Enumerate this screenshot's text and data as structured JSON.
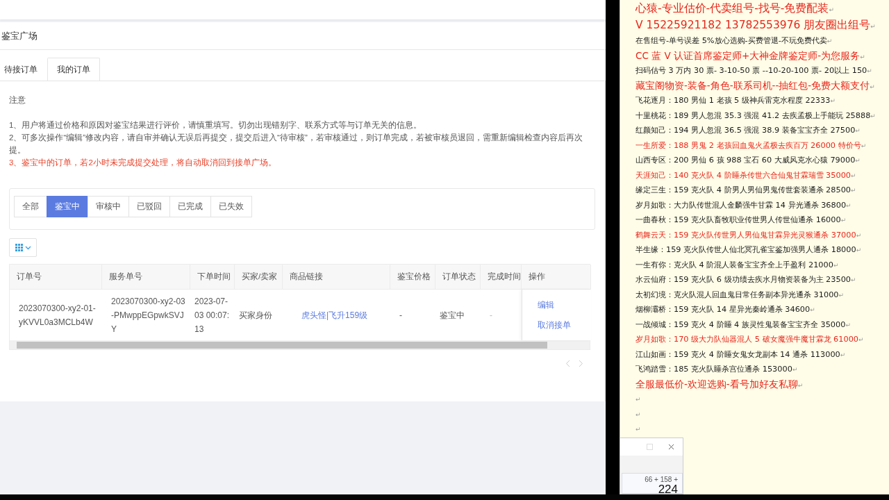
{
  "header": {
    "breadcrumb": "鉴宝广场"
  },
  "tabs": [
    {
      "label": "待接订单",
      "selected": false
    },
    {
      "label": "我的订单",
      "selected": true
    }
  ],
  "notice": {
    "title": "注意",
    "items": [
      {
        "kind": "normal",
        "text": "1、用户将通过价格和原因对鉴宝结果进行评价，请慎重填写。切勿出现错别字、联系方式等与订单无关的信息。"
      },
      {
        "kind": "normal",
        "text": "2、可多次操作“编辑”修改内容，请自审并确认无误后再提交，提交后进入“待审核”，若审核通过，则订单完成，若被审核员退回，需重新编辑检查内容后再次提。"
      },
      {
        "kind": "warning",
        "text": "3、鉴宝中的订单，若2小时未完成提交处理，将自动取消回到接单广场。"
      }
    ]
  },
  "filters": [
    {
      "label": "全部",
      "selected": false
    },
    {
      "label": "鉴宝中",
      "selected": true
    },
    {
      "label": "审核中",
      "selected": false
    },
    {
      "label": "已驳回",
      "selected": false
    },
    {
      "label": "已完成",
      "selected": false
    },
    {
      "label": "已失效",
      "selected": false
    }
  ],
  "table": {
    "columns": [
      "订单号",
      "服务单号",
      "下单时间",
      "买家/卖家",
      "商品链接",
      "鉴宝价格",
      "订单状态",
      "完成时间",
      "操作"
    ],
    "rows": [
      {
        "order_no": "2023070300-xy2-01-yKVVL0a3MCLb4W",
        "service_no": "2023070300-xy2-03-PMwppEGpwkSVJY",
        "time": "2023-07-03 00:07:13",
        "role": "买家身份",
        "link": "虎头怪|飞升159级",
        "price": "-",
        "status": "鉴宝中",
        "done_time": "-",
        "actions": [
          "编辑",
          "取消接单"
        ]
      }
    ]
  },
  "document": {
    "lines": [
      {
        "kind": "heading",
        "color": "#e8261c",
        "text": "心猿-专业估价-代卖组号-找号-免费配装",
        "mark": "↵"
      },
      {
        "kind": "heading",
        "color": "#e8261c",
        "text": "V 15225921182   13782553976 朋友圈出组号",
        "mark": "↵"
      },
      {
        "kind": "entry",
        "color": "#1a1a1a",
        "text": "在售组号-单号误差 5%放心选购-买费管退-不玩免费代卖",
        "mark": "↵"
      },
      {
        "kind": "subheading",
        "color": "#e8261c",
        "text": "CC 蓝 V 认证首席鉴定师+大神金牌鉴定师-为您服务",
        "mark": "↵"
      },
      {
        "kind": "entry",
        "color": "#1a1a1a",
        "text": "扫码估号 3 万内 30 票- 3-10-50 票  --10-20-100 票- 20以上 150",
        "mark": "↵"
      },
      {
        "kind": "subheading",
        "color": "#e8261c",
        "text": "藏宝阁物资-装备-角色-联系司机--抽红包-免费大额支付",
        "mark": "↵"
      },
      {
        "kind": "entry",
        "color": "#1a1a1a",
        "text": "飞花逐月：180 男仙 1 老孩 5 级神兵雷克水程度 22333",
        "mark": "↵"
      },
      {
        "kind": "entry",
        "color": "#1a1a1a",
        "text": "十里桃花：189 男人忽混 35.3 强混 41.2 去疾孟极上手能玩 25888",
        "mark": "↵"
      },
      {
        "kind": "entry",
        "color": "#1a1a1a",
        "text": "红颜知己：194 男人忽混 36.5 强混 38.9 装备宝宝齐全 27500",
        "mark": "↵"
      },
      {
        "kind": "entry",
        "color": "#e8261c",
        "text": "一生所爱：188 男鬼 2 老孩回血鬼火孟极去疾百万 26000 特价号",
        "mark": "↵"
      },
      {
        "kind": "entry",
        "color": "#1a1a1a",
        "text": "山西专区：200 男仙 6 孩 988 宝石 60 大威风克水心猿 79000",
        "mark": "↵"
      },
      {
        "kind": "entry",
        "color": "#e8261c",
        "text": "天涯知己：140 克火队 4 阶睡杀传世六合仙鬼甘霖瑞雪 35000",
        "mark": "↵"
      },
      {
        "kind": "entry",
        "color": "#1a1a1a",
        "text": "缘定三生：159 克火队 4 阶男人男仙男鬼传世套装通杀 28500",
        "mark": "↵"
      },
      {
        "kind": "entry",
        "color": "#1a1a1a",
        "text": "岁月如歌：大力队传世混人金麟强牛甘霖 14 异光通杀 36800",
        "mark": "↵"
      },
      {
        "kind": "entry",
        "color": "#1a1a1a",
        "text": "一曲春秋：159 克火队畜牧职业传世男人传世仙通杀 16000",
        "mark": "↵"
      },
      {
        "kind": "entry",
        "color": "#e8261c",
        "text": "鹤舞云天：159 克火队传世男人男仙鬼甘霖异光灵猴通杀 37000",
        "mark": "↵"
      },
      {
        "kind": "entry",
        "color": "#1a1a1a",
        "text": "半生缘：159 克火队传世人仙北冥孔雀宝鉴加强男人通杀 18000",
        "mark": "↵"
      },
      {
        "kind": "entry",
        "color": "#1a1a1a",
        "text": "一生有你：克火队 4 阶混人装备宝宝齐全上手盈利 21000",
        "mark": "↵"
      },
      {
        "kind": "entry",
        "color": "#1a1a1a",
        "text": "水云仙府：159 克火队 6 级功绩去疾水月物资装备为主 23500",
        "mark": "↵"
      },
      {
        "kind": "entry",
        "color": "#1a1a1a",
        "text": "太初幻境：克火队混人回血鬼日常任务副本异光通杀 31000",
        "mark": "↵"
      },
      {
        "kind": "entry",
        "color": "#1a1a1a",
        "text": "烟柳灞桥：159 克火队 14 星异光秦岭通杀 34600",
        "mark": "↵"
      },
      {
        "kind": "entry",
        "color": "#1a1a1a",
        "text": "一战倾城：159 克火 4 阶睡 4 族灵性鬼装备宝宝齐全 35000",
        "mark": "↵"
      },
      {
        "kind": "entry",
        "color": "#e8261c",
        "text": "岁月如歌：170 级大力队仙器混人 5 破女魔强牛魔甘霖龙 61000",
        "mark": "↵"
      },
      {
        "kind": "entry",
        "color": "#1a1a1a",
        "text": "江山如画：159 克火 4 阶睡女鬼女龙副本 14 通杀 113000",
        "mark": "↵"
      },
      {
        "kind": "entry",
        "color": "#1a1a1a",
        "text": "飞鸿踏雪：185 克火队睡杀宫位通杀 153000",
        "mark": "↵"
      },
      {
        "kind": "subheading",
        "color": "#e8261c",
        "text": "全服最低价-欢迎选购-看号加好友私聊",
        "mark": "↵"
      },
      {
        "kind": "empty",
        "mark": "↵"
      },
      {
        "kind": "empty",
        "mark": "↵"
      },
      {
        "kind": "empty",
        "mark": "↵"
      }
    ]
  },
  "calculator": {
    "expression": "66 + 158 +",
    "value": "224"
  }
}
